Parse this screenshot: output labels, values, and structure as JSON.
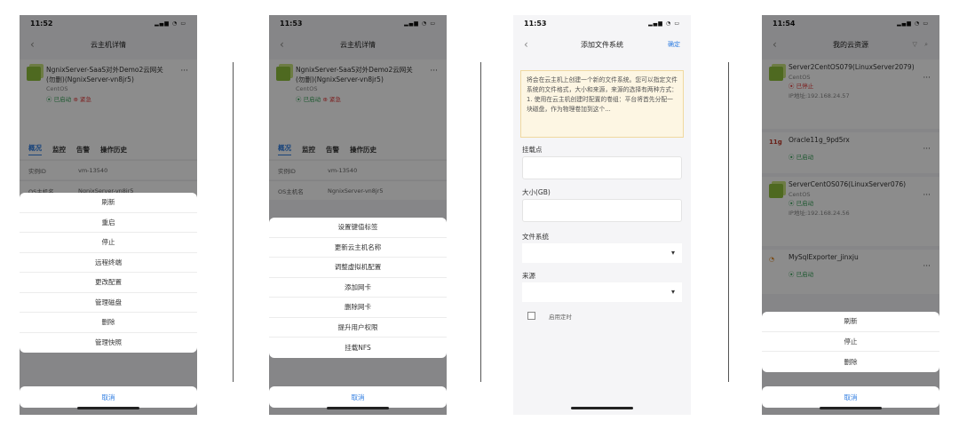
{
  "phone1": {
    "time": "11:52",
    "nav_title": "云主机详情",
    "host_name": "NgnixServer-SaaS对外Demo2云网关(勿删)(NgnixServer-vn8jr5)",
    "host_os": "CentOS",
    "status_running": "已启动",
    "status_urgent": "紧急",
    "tabs": [
      "概况",
      "监控",
      "告警",
      "操作历史"
    ],
    "kv": [
      {
        "k": "实例ID",
        "v": "vm-13540"
      },
      {
        "k": "OS主机名",
        "v": "NgnixServer-vn8jr5"
      }
    ],
    "sheet_items": [
      "刷新",
      "重启",
      "停止",
      "远程终端",
      "更改配置",
      "管理磁盘",
      "删除",
      "管理快照"
    ],
    "cancel": "取消"
  },
  "phone2": {
    "time": "11:53",
    "nav_title": "云主机详情",
    "host_name": "NgnixServer-SaaS对外Demo2云网关(勿删)(NgnixServer-vn8jr5)",
    "host_os": "CentOS",
    "status_running": "已启动",
    "status_urgent": "紧急",
    "tabs": [
      "概况",
      "监控",
      "告警",
      "操作历史"
    ],
    "kv": [
      {
        "k": "实例ID",
        "v": "vm-13540"
      },
      {
        "k": "OS主机名",
        "v": "NgnixServer-vn8jr5"
      }
    ],
    "sheet_items": [
      "设置键值标签",
      "更新云主机名称",
      "调整虚拟机配置",
      "添加网卡",
      "删除网卡",
      "提升用户权限",
      "挂载NFS"
    ],
    "cancel": "取消"
  },
  "phone3": {
    "time": "11:53",
    "nav_title": "添加文件系统",
    "confirm": "确定",
    "notice": "将会在云主机上创建一个新的文件系统。您可以指定文件系统的文件格式，大小和来源，来源的选择有两种方式：1. 使用在云主机创建时配置的卷组：平台将首先分配一块磁盘，作为物理卷加到这个...",
    "mount_label": "挂载点",
    "size_label": "大小(GB)",
    "fs_label": "文件系统",
    "source_label": "来源",
    "timer_label": "启用定时",
    "dropdown_glyph": "▾"
  },
  "phone4": {
    "time": "11:54",
    "nav_title": "我的云资源",
    "resources": [
      {
        "name": "Server2CentOS079(LinuxServer2079)",
        "os": "CentOS",
        "status": "已停止",
        "ip": "IP地址:192.168.24.57"
      },
      {
        "name": "Oracle11g_9pd5rx",
        "os": "",
        "status": "已启动",
        "ip": ""
      },
      {
        "name": "ServerCentOS076(LinuxServer076)",
        "os": "CentOS",
        "status": "已启动",
        "ip": "IP地址:192.168.24.56"
      },
      {
        "name": "MySqlExporter_jinxju",
        "os": "",
        "status": "已启动",
        "ip": ""
      }
    ],
    "sheet_items": [
      "刷新",
      "停止",
      "删除"
    ],
    "cancel": "取消"
  },
  "colors": {
    "accent": "#2f7de1",
    "ok": "#3aa35b",
    "danger": "#e23c3c",
    "notice_bg": "#fdf6e3"
  }
}
